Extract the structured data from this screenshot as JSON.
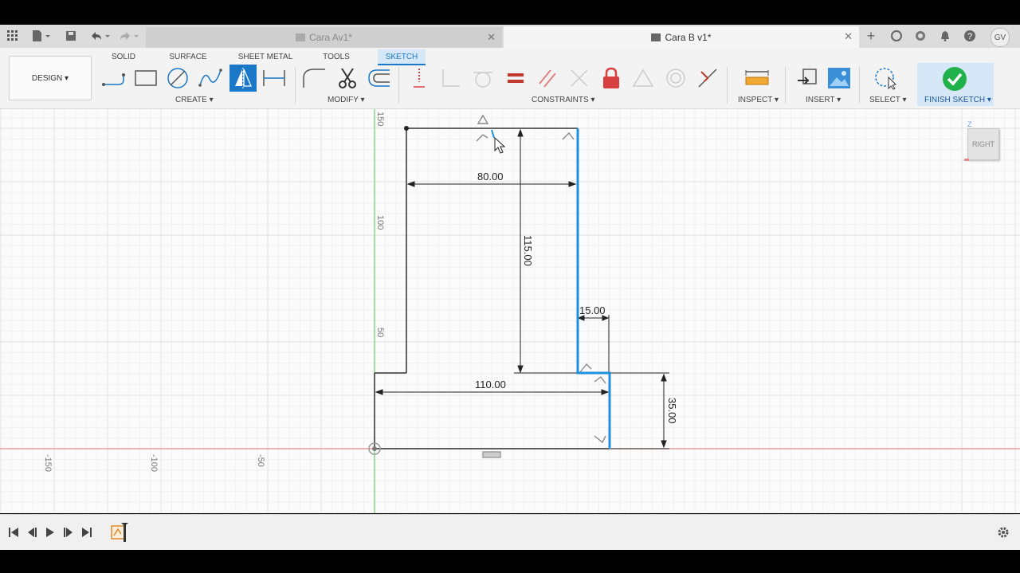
{
  "tabs": {
    "inactive_title": "Cara Av1*",
    "active_title": "Cara B v1*",
    "user_initials": "GV"
  },
  "workspace_tabs": [
    "SOLID",
    "SURFACE",
    "SHEET METAL",
    "TOOLS",
    "SKETCH"
  ],
  "design_label": "DESIGN ▾",
  "groups": {
    "create": "CREATE ▾",
    "modify": "MODIFY ▾",
    "constraints": "CONSTRAINTS ▾",
    "inspect": "INSPECT ▾",
    "insert": "INSERT ▾",
    "select": "SELECT ▾",
    "finish": "FINISH SKETCH ▾"
  },
  "sketch": {
    "dimensions": [
      "80.00",
      "115.00",
      "15.00",
      "110.00",
      "35.00"
    ],
    "axis_ticks_vertical": [
      "150",
      "100",
      "50"
    ],
    "axis_ticks_horizontal": [
      "-150",
      "-100",
      "-50"
    ]
  },
  "viewcube": {
    "label": "RIGHT",
    "axis_z": "Z"
  },
  "colors": {
    "accent": "#1b78c8",
    "selected_line": "#1f8fe0",
    "finish_green": "#21b14b",
    "x_axis": "#e58a8a",
    "y_axis": "#66d166"
  }
}
